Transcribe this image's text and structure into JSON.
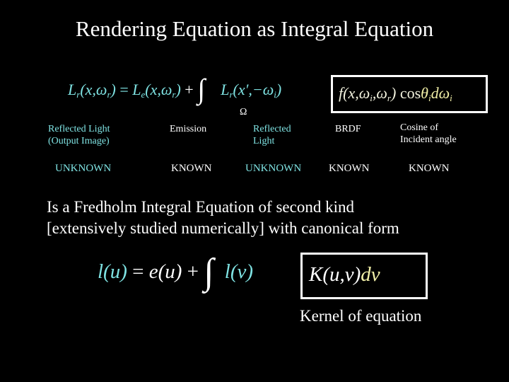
{
  "slide": {
    "background_color": "#000000",
    "title": "Rendering Equation as Integral Equation",
    "accent_cyan": "#7fe3e3",
    "accent_yellow": "#f2f0a8",
    "text_white": "#ffffff"
  },
  "equation_top": {
    "full_text": "L_r(x, ω_r) = L_e(x, ω_r) + ∫_Ω L_r(x', −ω_i) f(x, ω_i, ω_r) cos θ_i dω_i",
    "lhs_L": "L",
    "lhs_sub": "r",
    "lhs_args": "(x,ω",
    "lhs_args_sub": "r",
    "lhs_close": ")",
    "equals": " = ",
    "emission_L": "L",
    "emission_sub": "e",
    "emission_args": "(x,ω",
    "emission_args_sub": "r",
    "emission_close": ")",
    "plus": " + ",
    "integral_glyph": "∫",
    "integral_limit": "Ω",
    "radiance_L": "L",
    "radiance_sub": "r",
    "radiance_args": "(x′,−ω",
    "radiance_args_sub": "i",
    "radiance_close": ")",
    "brdf_f": "f",
    "brdf_args_open": "(x,ω",
    "brdf_sub_i": "i",
    "brdf_args_mid": ",ω",
    "brdf_sub_r": "r",
    "brdf_args_close": ")",
    "cos": " cos",
    "theta": "θ",
    "theta_sub": "i",
    "d": "d",
    "omega": "ω",
    "omega_sub": "i"
  },
  "labels": {
    "row1": [
      {
        "text_line1": "Reflected Light",
        "text_line2": "(Output Image)",
        "color": "#7fe3e3"
      },
      {
        "text_line1": "Emission",
        "text_line2": "",
        "color": "#ffffff"
      },
      {
        "text_line1": "Reflected",
        "text_line2": "Light",
        "color": "#7fe3e3"
      },
      {
        "text_line1": "BRDF",
        "text_line2": "",
        "color": "#ffffff"
      },
      {
        "text_line1": "Cosine of",
        "text_line2": "Incident angle",
        "color": "#ffffff"
      }
    ],
    "row2": [
      {
        "text": "UNKNOWN",
        "color": "#7fe3e3"
      },
      {
        "text": "KNOWN",
        "color": "#ffffff"
      },
      {
        "text": "UNKNOWN",
        "color": "#7fe3e3"
      },
      {
        "text": "KNOWN",
        "color": "#ffffff"
      },
      {
        "text": "KNOWN",
        "color": "#ffffff"
      }
    ]
  },
  "body": {
    "line1": "Is a Fredholm Integral Equation of second kind",
    "line2": "[extensively studied numerically] with canonical form"
  },
  "equation_bottom": {
    "full_text": "l(u) = e(u) + ∫ l(v) K(u,v) dv",
    "l_u": "l(u)",
    "equals": " = ",
    "e_u": "e(u)",
    "plus": " + ",
    "integral_glyph": "∫",
    "l_v": " l(v)",
    "kernel_K": "K(u,v)",
    "kernel_dv": "dv"
  },
  "kernel_caption": "Kernel of equation"
}
